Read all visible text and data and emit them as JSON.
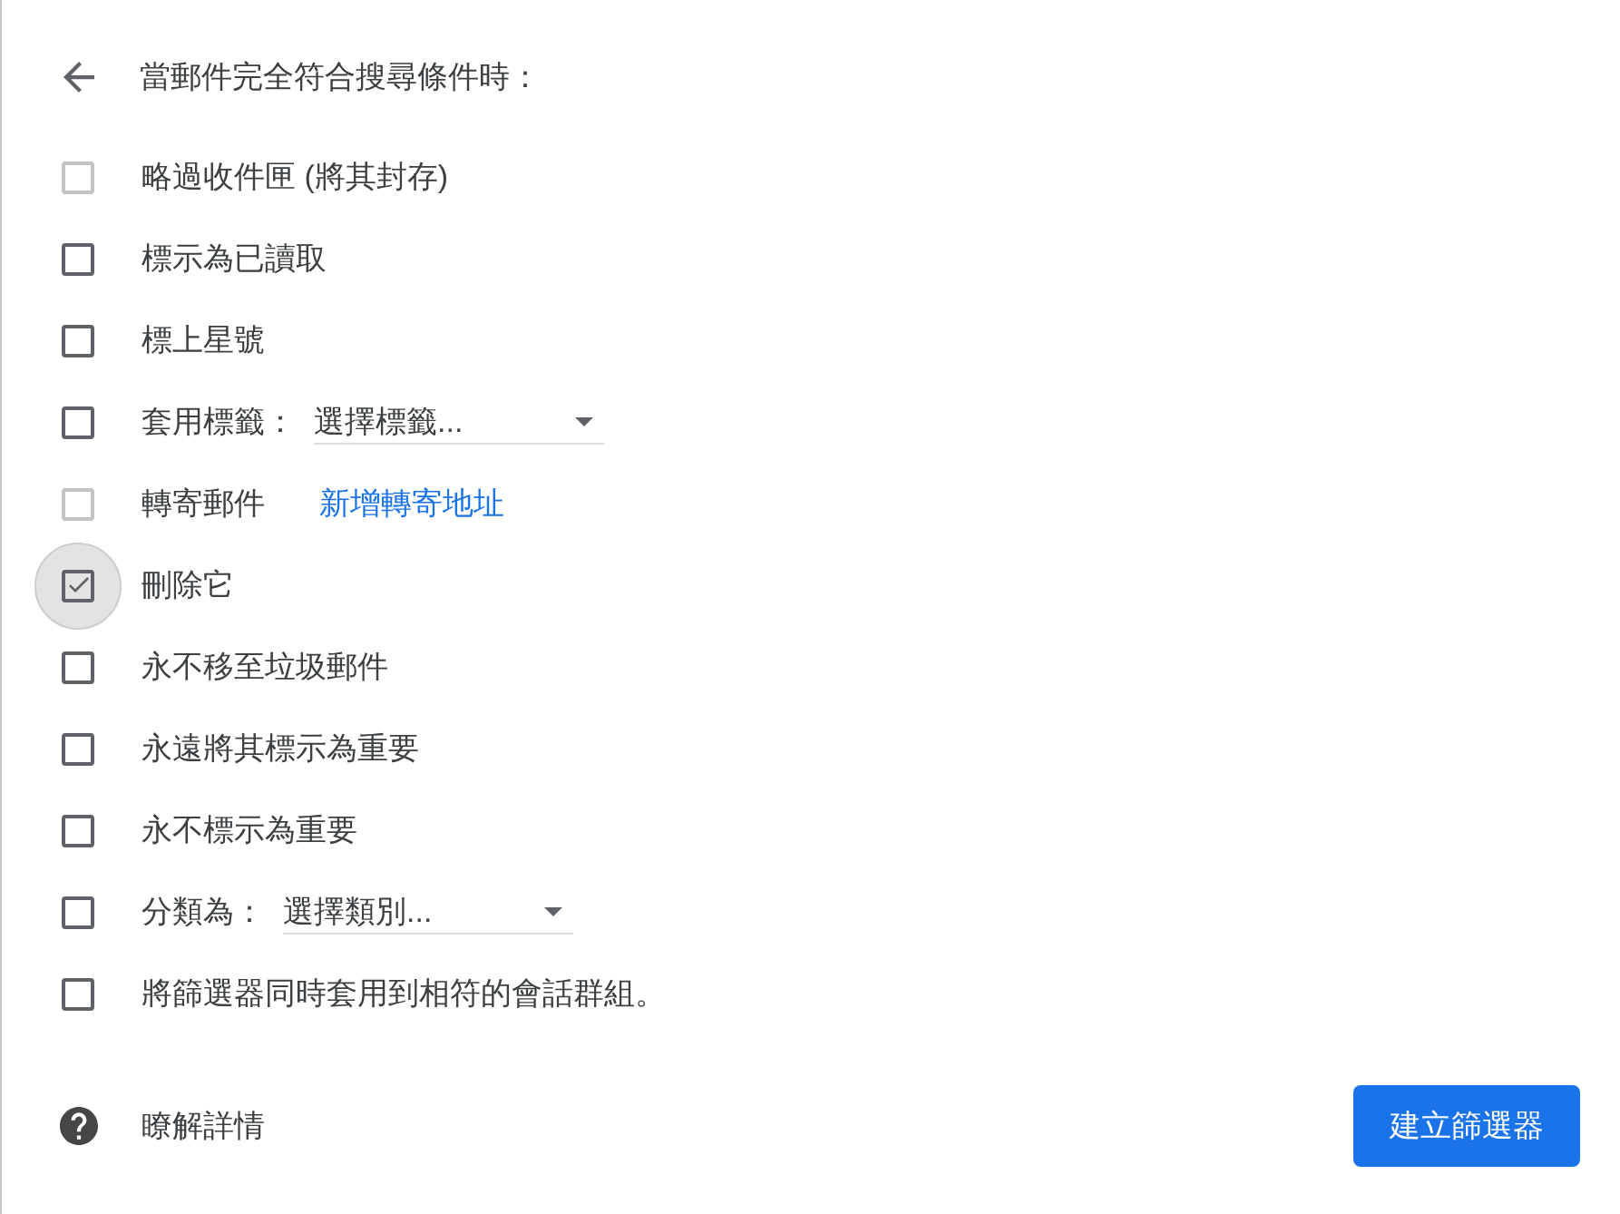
{
  "header": {
    "title": "當郵件完全符合搜尋條件時："
  },
  "actions": [
    {
      "kind": "checkbox",
      "label": "略過收件匣 (將其封存)",
      "checked": false,
      "disabled": true,
      "focused": false
    },
    {
      "kind": "checkbox",
      "label": "標示為已讀取",
      "checked": false,
      "disabled": false,
      "focused": false
    },
    {
      "kind": "checkbox",
      "label": "標上星號",
      "checked": false,
      "disabled": false,
      "focused": false
    },
    {
      "kind": "select",
      "label": "套用標籤：",
      "value": "選擇標籤...",
      "checked": false,
      "disabled": false,
      "focused": false
    },
    {
      "kind": "link",
      "label": "轉寄郵件",
      "link": "新增轉寄地址",
      "checked": false,
      "disabled": true,
      "focused": false
    },
    {
      "kind": "checkbox",
      "label": "刪除它",
      "checked": true,
      "disabled": false,
      "focused": true
    },
    {
      "kind": "checkbox",
      "label": "永不移至垃圾郵件",
      "checked": false,
      "disabled": false,
      "focused": false
    },
    {
      "kind": "checkbox",
      "label": "永遠將其標示為重要",
      "checked": false,
      "disabled": false,
      "focused": false
    },
    {
      "kind": "checkbox",
      "label": "永不標示為重要",
      "checked": false,
      "disabled": false,
      "focused": false
    },
    {
      "kind": "select",
      "label": "分類為：",
      "value": "選擇類別...",
      "checked": false,
      "disabled": false,
      "focused": false
    },
    {
      "kind": "checkbox",
      "label": "將篩選器同時套用到相符的會話群組。",
      "checked": false,
      "disabled": false,
      "focused": false
    }
  ],
  "footer": {
    "help": "瞭解詳情",
    "button": "建立篩選器"
  }
}
